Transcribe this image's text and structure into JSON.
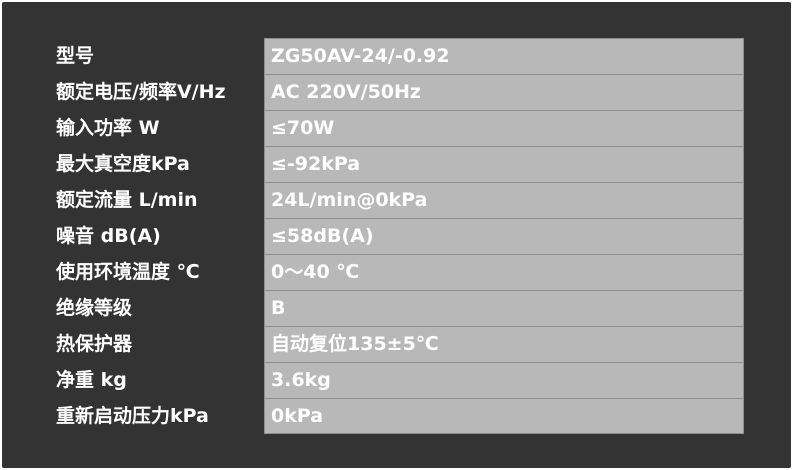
{
  "specs": [
    {
      "label": "型号",
      "value": "ZG50AV-24/-0.92"
    },
    {
      "label": "额定电压/频率V/Hz",
      "value": "AC 220V/50Hz"
    },
    {
      "label": "输入功率 W",
      "value": "≤70W"
    },
    {
      "label": "最大真空度kPa",
      "value": "≤-92kPa"
    },
    {
      "label": "额定流量 L/min",
      "value": "24L/min@0kPa"
    },
    {
      "label": "噪音 dB(A)",
      "value": "≤58dB(A)"
    },
    {
      "label": "使用环境温度  ℃",
      "value": "0～40 ℃"
    },
    {
      "label": "绝缘等级",
      "value": "B"
    },
    {
      "label": "热保护器",
      "value": "自动复位135±5℃"
    },
    {
      "label": "净重  kg",
      "value": "3.6kg"
    },
    {
      "label": "重新启动压力kPa",
      "value": "0kPa"
    }
  ]
}
